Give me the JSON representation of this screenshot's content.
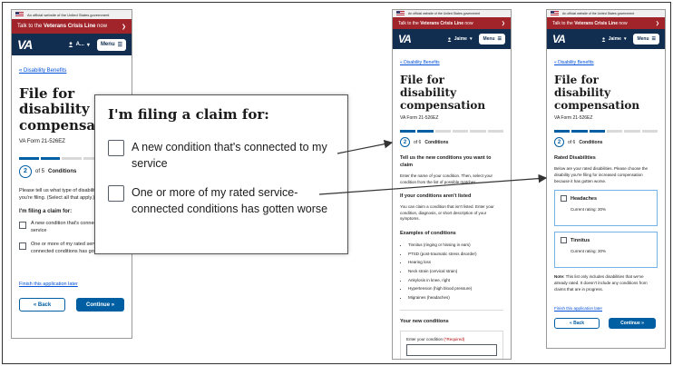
{
  "banner": {
    "gov_text": "An official website of the United States government"
  },
  "crisis": {
    "prefix": "Talk to the ",
    "bold": "Veterans Crisis Line",
    "suffix": " now",
    "arrow": "❯"
  },
  "header": {
    "logo": "VA",
    "user_p1": "A...",
    "user_other": "Jaime",
    "menu_label": "Menu"
  },
  "p1": {
    "breadcrumb": "« Disability Benefits",
    "title": "File for disability compensation",
    "form_no": "VA Form 21-526EZ",
    "progress_total": 5,
    "progress_done": 2,
    "step_num": "2",
    "step_of": "of 5",
    "step_name": "Conditions",
    "intro": "Please tell us what type of disability claims you're filing. (Select all that apply.)",
    "question": "I'm filing a claim for:",
    "options": [
      "A new condition that's connected to my service",
      "One or more of my rated service-connected conditions has gotten worse"
    ],
    "finish": "Finish this application later",
    "back": "« Back",
    "continue": "Continue »"
  },
  "popup": {
    "title": "I'm filing a claim for:",
    "options": [
      "A new condition that's connected to my service",
      "One or more of my rated service-connected conditions has gotten worse"
    ]
  },
  "p2": {
    "breadcrumb": "« Disability Benefits",
    "title": "File for disability compensation",
    "form_no": "VA Form 21-526EZ",
    "progress_total": 6,
    "progress_done": 2,
    "step_num": "2",
    "step_of": "of 6",
    "step_name": "Conditions",
    "sub1": "Tell us the new conditions you want to claim",
    "txt1": "Enter the name of your condition. Then, select your condition from the list of possible matches.",
    "sub2": "If your conditions aren't listed",
    "txt2": "You can claim a condition that isn't listed. Enter your condition, diagnosis, or short description of your symptoms.",
    "sub3": "Examples of conditions",
    "examples": [
      "Tinnitus (ringing or hissing in ears)",
      "PTSD (post-traumatic stress disorder)",
      "Hearing loss",
      "Neck strain (cervical strain)",
      "Ankylosis in knee, right",
      "Hypertension (high blood pressure)",
      "Migraines (headaches)"
    ],
    "sub4": "Your new conditions",
    "field_label": "Enter your condition",
    "field_req": " (*Required)"
  },
  "p3": {
    "breadcrumb": "« Disability Benefits",
    "title": "File for disability compensation",
    "form_no": "VA Form 21-526EZ",
    "progress_total": 6,
    "progress_done": 3,
    "step_num": "2",
    "step_of": "of 6",
    "step_name": "Conditions",
    "sub1": "Rated Disabilities",
    "txt1": "Below are your rated disabilities. Please choose the disability you're filing for increased compensation because it has gotten worse.",
    "cards": [
      {
        "title": "Headaches",
        "rating": "Current rating: 30%"
      },
      {
        "title": "Tinnitus",
        "rating": "Current rating: 30%"
      }
    ],
    "note_bold": "Note:",
    "note": " This list only includes disabilities that we've already rated. It doesn't include any conditions from claims that are in progress.",
    "finish": "Finish this application later",
    "back": "« Back",
    "continue": "Continue »"
  }
}
